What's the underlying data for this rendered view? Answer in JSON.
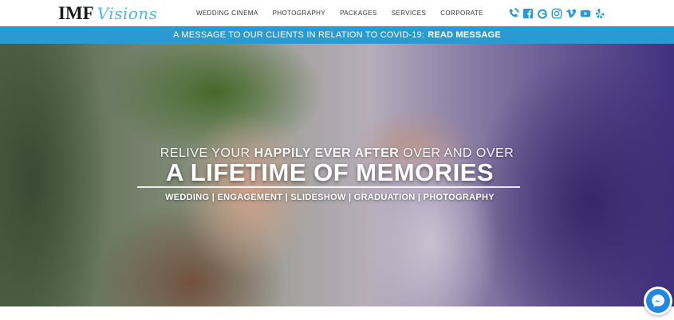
{
  "brand": {
    "name_bold": "IMF",
    "name_script": "Visions"
  },
  "nav": {
    "items": [
      {
        "label": "WEDDING CINEMA"
      },
      {
        "label": "PHOTOGRAPHY"
      },
      {
        "label": "PACKAGES"
      },
      {
        "label": "SERVICES"
      },
      {
        "label": "CORPORATE"
      }
    ]
  },
  "social": {
    "accent_color": "#2a9ad3",
    "icons": [
      "phone-icon",
      "facebook-icon",
      "google-icon",
      "instagram-icon",
      "vimeo-icon",
      "youtube-icon",
      "yelp-icon"
    ]
  },
  "banner": {
    "text": "A MESSAGE TO OUR CLIENTS IN RELATION TO COVID-19:",
    "link_label": "READ MESSAGE",
    "background": "#2a9ad3"
  },
  "hero": {
    "tagline_pre": "RELIVE YOUR",
    "tagline_bold": "HAPPILY EVER AFTER",
    "tagline_post": "OVER AND OVER",
    "headline": "A LIFETIME OF MEMORIES",
    "services": "WEDDING | ENGAGEMENT | SLIDESHOW | GRADUATION | PHOTOGRAPHY"
  },
  "chat": {
    "icon": "messenger-icon"
  }
}
